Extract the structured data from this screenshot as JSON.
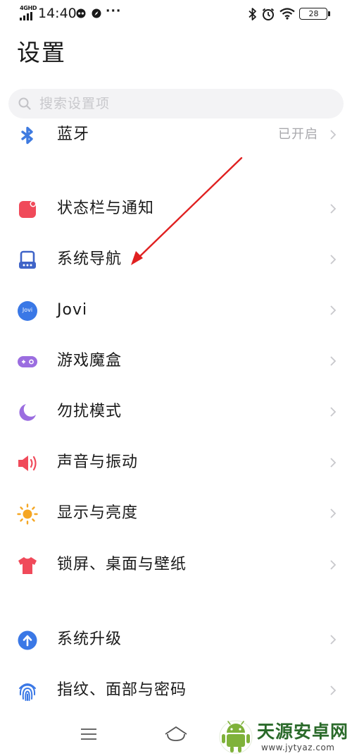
{
  "status_bar": {
    "network": "4GHD",
    "time": "14:40",
    "more": "···",
    "battery": "28"
  },
  "title": "设置",
  "search": {
    "placeholder": "搜索设置项"
  },
  "items": [
    {
      "key": "bluetooth",
      "label": "蓝牙",
      "value": "已开启",
      "icon": "bluetooth-icon"
    },
    {
      "key": "status-bar",
      "label": "状态栏与通知",
      "icon": "notification-icon"
    },
    {
      "key": "system-nav",
      "label": "系统导航",
      "icon": "navigation-icon"
    },
    {
      "key": "jovi",
      "label": "Jovi",
      "icon": "jovi-icon",
      "icon_text": "Jovi"
    },
    {
      "key": "game-box",
      "label": "游戏魔盒",
      "icon": "gamepad-icon"
    },
    {
      "key": "dnd",
      "label": "勿扰模式",
      "icon": "moon-icon"
    },
    {
      "key": "sound",
      "label": "声音与振动",
      "icon": "speaker-icon"
    },
    {
      "key": "display",
      "label": "显示与亮度",
      "icon": "sun-icon"
    },
    {
      "key": "wallpaper",
      "label": "锁屏、桌面与壁纸",
      "icon": "shirt-icon"
    },
    {
      "key": "update",
      "label": "系统升级",
      "icon": "upgrade-icon"
    },
    {
      "key": "fingerprint",
      "label": "指纹、面部与密码",
      "icon": "fingerprint-icon"
    }
  ],
  "watermark": {
    "brand": "天源安卓网",
    "url": "www.jytyaz.com"
  },
  "colors": {
    "bluetooth": "#3f7be0",
    "notification": "#f04a5a",
    "navigation": "#3f64c8",
    "jovi": "#3a78e6",
    "gamepad": "#9b6de0",
    "moon": "#9b6de0",
    "speaker": "#f04a5a",
    "sun": "#f5a623",
    "shirt": "#f04a5a",
    "upgrade": "#3a78e6",
    "fingerprint": "#3a78e6",
    "arrow": "#e02020"
  }
}
